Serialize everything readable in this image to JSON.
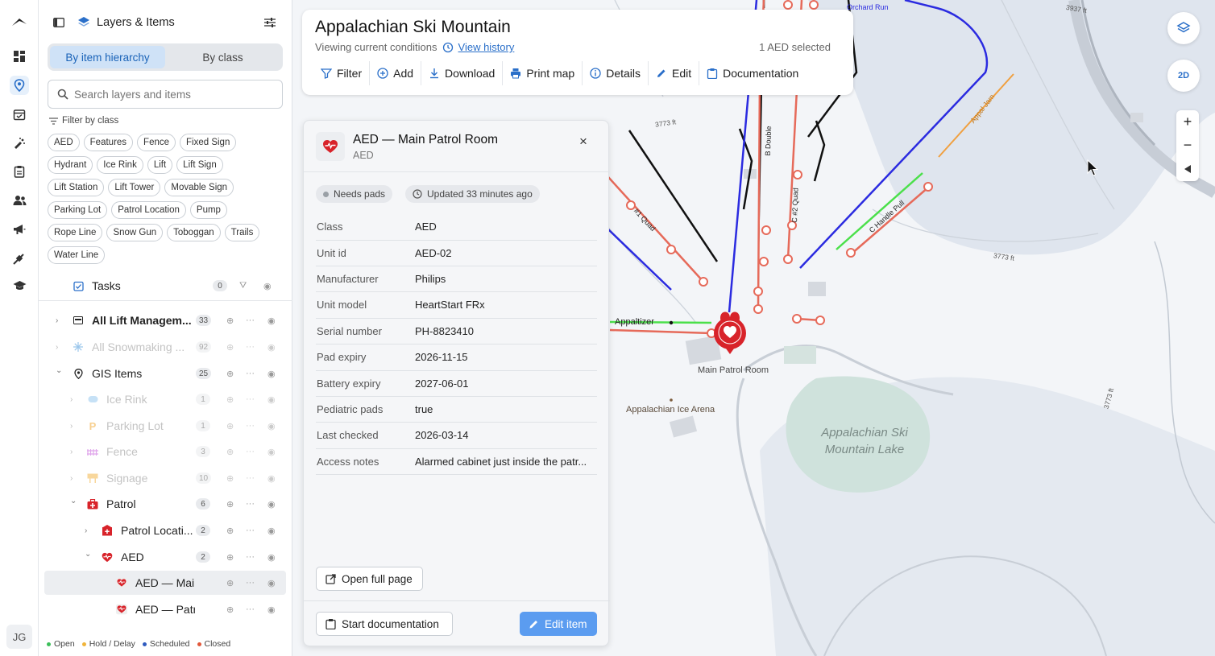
{
  "sidebar": {
    "title": "Layers & Items",
    "tabs": [
      "By item hierarchy",
      "By class"
    ],
    "search_placeholder": "Search layers and items",
    "filter_label": "Filter by class",
    "chips": [
      "AED",
      "Features",
      "Fence",
      "Fixed Sign",
      "Hydrant",
      "Ice Rink",
      "Lift",
      "Lift Sign",
      "Lift Station",
      "Lift Tower",
      "Movable Sign",
      "Parking Lot",
      "Patrol Location",
      "Pump",
      "Rope Line",
      "Snow Gun",
      "Toboggan",
      "Trails",
      "Water Line"
    ],
    "tasks": {
      "label": "Tasks",
      "count": "0"
    },
    "tree": [
      {
        "label": "All Lift Managem...",
        "count": "33"
      },
      {
        "label": "All Snowmaking ...",
        "count": "92"
      },
      {
        "label": "GIS Items",
        "count": "25"
      },
      {
        "label": "Ice Rink",
        "count": "1"
      },
      {
        "label": "Parking Lot",
        "count": "1"
      },
      {
        "label": "Fence",
        "count": "3"
      },
      {
        "label": "Signage",
        "count": "10"
      },
      {
        "label": "Patrol",
        "count": "6"
      },
      {
        "label": "Patrol Locati...",
        "count": "2"
      },
      {
        "label": "AED",
        "count": "2"
      },
      {
        "label": "AED — Main P...",
        "count": ""
      },
      {
        "label": "AED — Patrol ...",
        "count": ""
      }
    ],
    "legend": [
      {
        "label": "Open",
        "color": "#3cbf5a"
      },
      {
        "label": "Hold / Delay",
        "color": "#f0b43a"
      },
      {
        "label": "Scheduled",
        "color": "#2f5bbf"
      },
      {
        "label": "Closed",
        "color": "#e2583a"
      }
    ],
    "user_initials": "JG"
  },
  "header": {
    "title": "Appalachian Ski Mountain",
    "subtitle": "Viewing current conditions",
    "history_link": "View history",
    "selection": "1 AED selected",
    "tools": [
      "Filter",
      "Add",
      "Download",
      "Print map",
      "Details",
      "Edit",
      "Documentation"
    ]
  },
  "card": {
    "title": "AED — Main Patrol Room",
    "subtitle": "AED",
    "status": "Needs pads",
    "updated": "Updated 33 minutes ago",
    "props": [
      {
        "k": "Class",
        "v": "AED"
      },
      {
        "k": "Unit id",
        "v": "AED-02"
      },
      {
        "k": "Manufacturer",
        "v": "Philips"
      },
      {
        "k": "Unit model",
        "v": "HeartStart FRx"
      },
      {
        "k": "Serial number",
        "v": "PH-8823410"
      },
      {
        "k": "Pad expiry",
        "v": "2026-11-15"
      },
      {
        "k": "Battery expiry",
        "v": "2027-06-01"
      },
      {
        "k": "Pediatric pads",
        "v": "true"
      },
      {
        "k": "Last checked",
        "v": "2026-03-14"
      },
      {
        "k": "Access notes",
        "v": "Alarmed cabinet just inside the patr..."
      }
    ],
    "open_full": "Open full page",
    "start_doc": "Start documentation",
    "edit_item": "Edit item"
  },
  "map": {
    "labels": {
      "main_patrol": "Main Patrol Room",
      "ice_arena": "Appalachian Ice Arena",
      "lake": "Appalachian Ski Mountain Lake",
      "appaltizer": "Appaltizer",
      "orchard_run": "Orchard Run",
      "appal_jam": "Appal Jam",
      "b_double": "B Double",
      "c_quad": "C #2 Quad",
      "a_quad": "#1 Quad",
      "handle_pull": "C Handle Pull",
      "contour_3773": "3773 ft",
      "contour_3937": "3937 ft"
    },
    "view_mode": "2D",
    "zoom_in": "+",
    "zoom_out": "−",
    "accent": "#d8232a"
  }
}
